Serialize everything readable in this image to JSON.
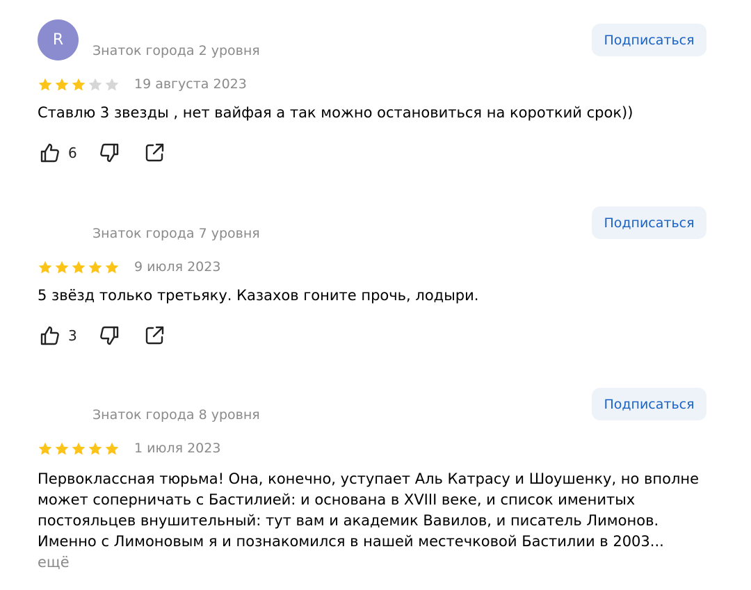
{
  "reviews": [
    {
      "avatar_letter": "R",
      "level": "Знаток города 2 уровня",
      "subscribe_label": "Подписаться",
      "rating": 3,
      "date": "19 августа 2023",
      "text": "Ставлю 3 звезды , нет вайфая а так можно остановиться на короткий срок))",
      "likes": "6"
    },
    {
      "avatar_letter": "",
      "level": "Знаток города 7 уровня",
      "subscribe_label": "Подписаться",
      "rating": 5,
      "date": "9 июля 2023",
      "text": "5 звёзд только третьяку. Казахов гоните прочь, лодыри.",
      "likes": "3"
    },
    {
      "avatar_letter": "",
      "level": "Знаток города 8 уровня",
      "subscribe_label": "Подписаться",
      "rating": 5,
      "date": "1 июля 2023",
      "text": "Первоклассная тюрьма! Она, конечно, уступает Аль Катрасу и Шоушенку, но вполне может соперничать с Бастилией: и основана в XVIII веке, и список именитых постояльцев внушительный: тут вам и академик Вавилов, и писатель Лимонов. Именно с Лимоновым я и познакомился в нашей местечковой Бастилии в 2003...",
      "more_label": "ещё"
    }
  ],
  "colors": {
    "star_filled": "#fcc419",
    "star_empty": "#d6d6d6",
    "subscribe_bg": "#eef3f9",
    "subscribe_text": "#1a62c4",
    "avatar_bg": "#8b8ccf"
  },
  "icons": [
    "thumbs-up-icon",
    "thumbs-down-icon",
    "share-icon",
    "star-icon"
  ]
}
